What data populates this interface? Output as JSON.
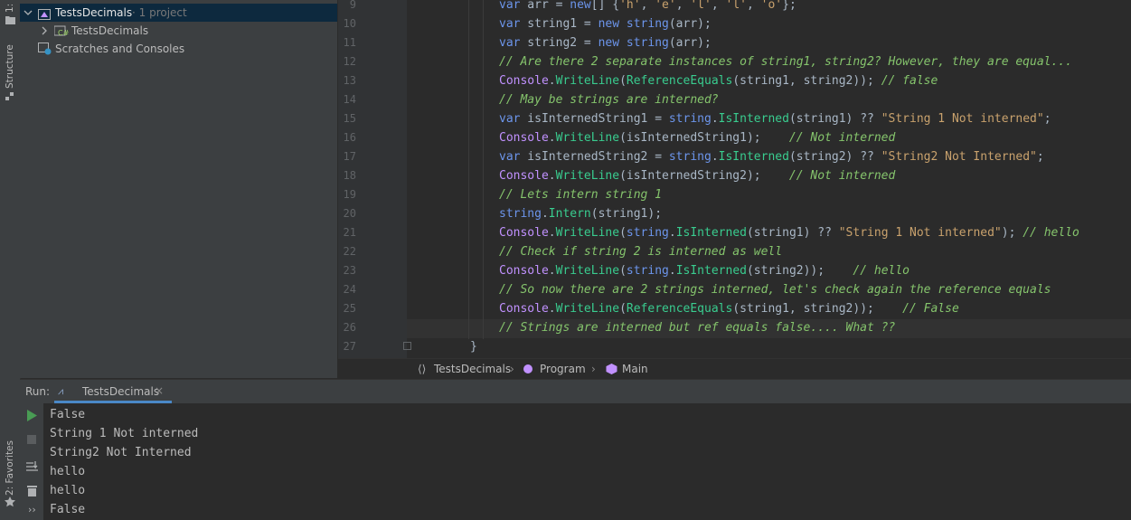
{
  "left_strip": {
    "top_label": "1:",
    "structure_label": "Structure",
    "favorites_label": "2: Favorites"
  },
  "project": {
    "root_name": "TestsDecimals",
    "root_suffix": "· 1 project",
    "child_name": "TestsDecimals",
    "scratches": "Scratches and Consoles"
  },
  "editor": {
    "line_numbers": [
      "9",
      "10",
      "11",
      "12",
      "13",
      "14",
      "15",
      "16",
      "17",
      "18",
      "19",
      "20",
      "21",
      "22",
      "23",
      "24",
      "25",
      "26",
      "27"
    ],
    "current_line_index": 17
  },
  "breadcrumb": {
    "namespace": "TestsDecimals",
    "class": "Program",
    "method": "Main"
  },
  "run": {
    "label": "Run:",
    "tab_title": "TestsDecimals",
    "output": [
      "False",
      "String 1 Not interned",
      "String2 Not Interned",
      "hello",
      "hello",
      "False"
    ]
  },
  "colors": {
    "background": "#2b2b2b",
    "panel": "#3c3f41",
    "keyword": "#6c95eb",
    "string": "#c9a26d",
    "comment": "#85c46c",
    "class": "#c191ff",
    "method": "#39cc8f",
    "run_green": "#499c54"
  }
}
